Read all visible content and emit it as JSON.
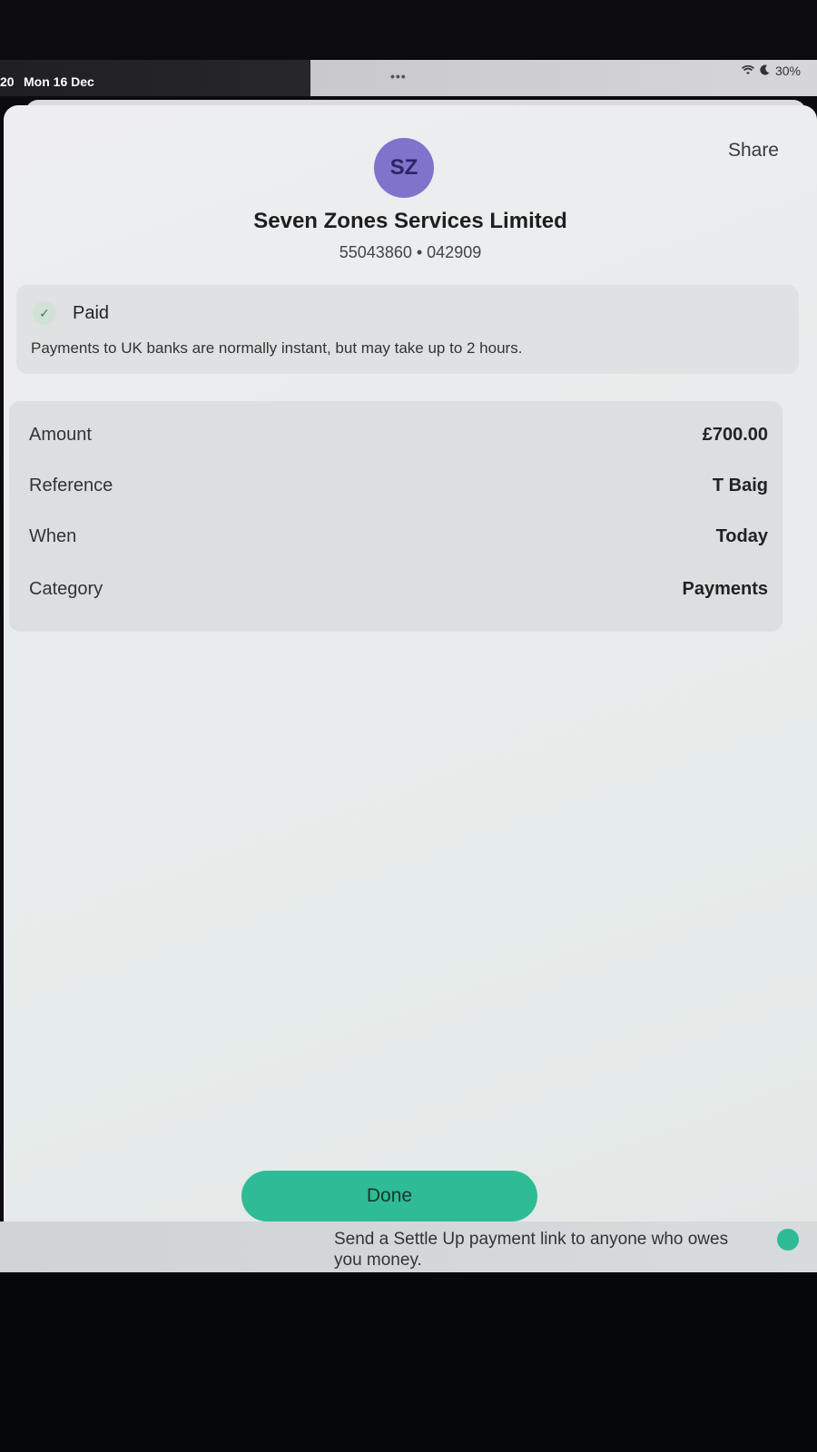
{
  "status_bar": {
    "time": "20",
    "date": "Mon 16 Dec",
    "dots": "•••",
    "battery": "30%"
  },
  "header": {
    "share_label": "Share",
    "avatar_initials": "SZ",
    "payee_name": "Seven Zones Services Limited",
    "account_info": "55043860 • 042909"
  },
  "status": {
    "label": "Paid",
    "note": "Payments to UK banks are normally instant, but may take up to 2 hours."
  },
  "details": [
    {
      "label": "Amount",
      "value": "£700.00"
    },
    {
      "label": "Reference",
      "value": "T Baig"
    },
    {
      "label": "When",
      "value": "Today"
    },
    {
      "label": "Category",
      "value": "Payments"
    }
  ],
  "done_label": "Done",
  "background_promo": "Send a Settle Up payment link to anyone who owes you money.",
  "colors": {
    "accent": "#2ebc96",
    "avatar": "#7f74cc"
  }
}
